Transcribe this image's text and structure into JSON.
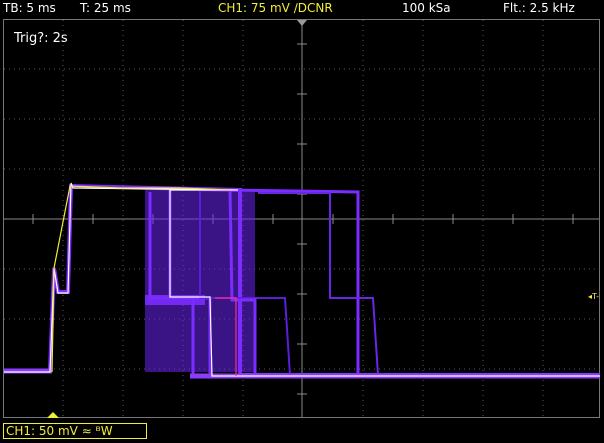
{
  "header": {
    "timebase": "TB: 5 ms",
    "trigger_time": "T: 25 ms",
    "channel": "CH1: 75 mV ∕DCNR",
    "sample_rate": "100 kSa",
    "filter": "Flt.: 2.5 kHz"
  },
  "overlay": {
    "trigger_status": "Trig?: 2s"
  },
  "footer": {
    "channel_status": "CH1: 50 mV ≈ ᴮW"
  },
  "markers": {
    "trigger_level": "◂T-"
  },
  "colors": {
    "trace": "#7b2cff",
    "trace_dark": "#4e1ad6",
    "bright": "#ffffff",
    "highlight": "#ff2a8a",
    "accent": "#f2ec3a",
    "grid": "#7a7a7a"
  }
}
